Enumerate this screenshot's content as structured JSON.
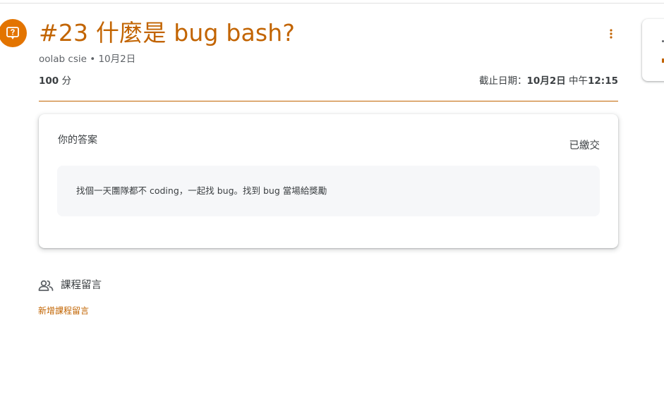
{
  "assignment": {
    "title": "#23 什麼是 bug bash?",
    "meta": "oolab csie • 10月2日",
    "points_value": "100",
    "points_unit": " 分",
    "due_label": "截止日期：",
    "due_date": "10月2日",
    "due_period": " 中午",
    "due_time": "12:15"
  },
  "answer": {
    "title": "你的答案",
    "status": "已繳交",
    "text": "找個一天團隊都不 coding，一起找 bug。找到 bug 當場給獎勵"
  },
  "comments": {
    "label": "課程留言",
    "add_link": "新增課程留言"
  },
  "icons": {
    "type_icon": "question-assignment-icon",
    "menu_icon": "more-vert-icon",
    "people_icon": "people-icon"
  },
  "colors": {
    "accent": "#c26401",
    "icon_bg": "#e37400",
    "answer_box_bg": "#f6f7f9"
  }
}
